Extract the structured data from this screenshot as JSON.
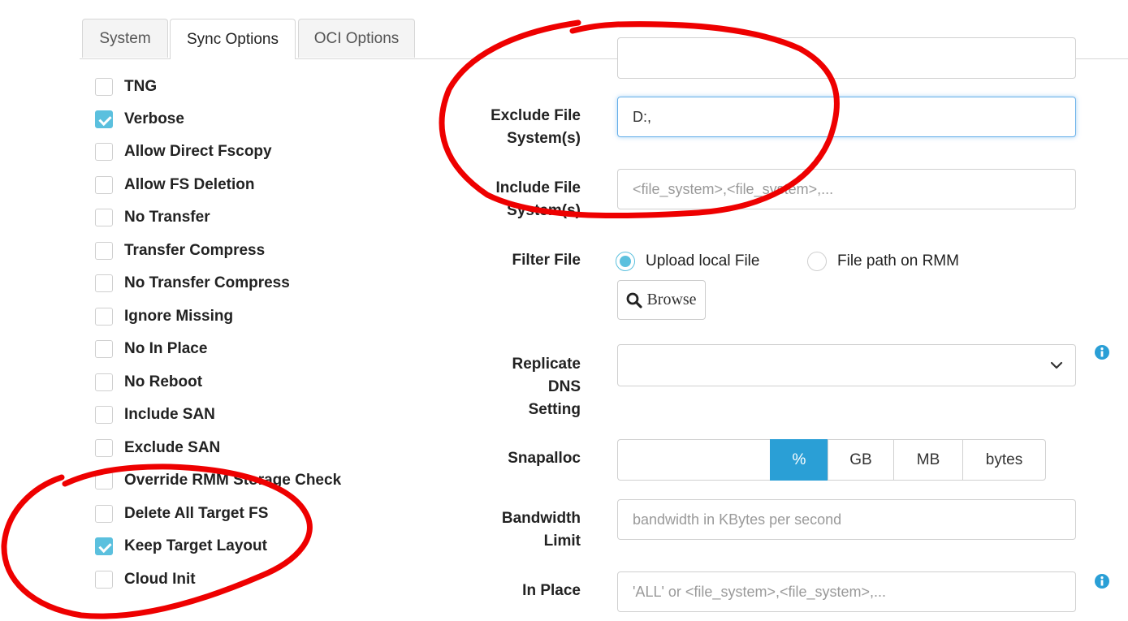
{
  "tabs": [
    {
      "label": "System",
      "active": false
    },
    {
      "label": "Sync Options",
      "active": true
    },
    {
      "label": "OCI Options",
      "active": false
    }
  ],
  "options": [
    {
      "label": "TNG",
      "checked": false
    },
    {
      "label": "Verbose",
      "checked": true
    },
    {
      "label": "Allow Direct Fscopy",
      "checked": false
    },
    {
      "label": "Allow FS Deletion",
      "checked": false
    },
    {
      "label": "No Transfer",
      "checked": false
    },
    {
      "label": "Transfer Compress",
      "checked": false
    },
    {
      "label": "No Transfer Compress",
      "checked": false
    },
    {
      "label": "Ignore Missing",
      "checked": false
    },
    {
      "label": "No In Place",
      "checked": false
    },
    {
      "label": "No Reboot",
      "checked": false
    },
    {
      "label": "Include SAN",
      "checked": false
    },
    {
      "label": "Exclude SAN",
      "checked": false
    },
    {
      "label": "Override RMM Storage Check",
      "checked": false
    },
    {
      "label": "Delete All Target FS",
      "checked": false
    },
    {
      "label": "Keep Target Layout",
      "checked": true
    },
    {
      "label": "Cloud Init",
      "checked": false
    }
  ],
  "form": {
    "exclude_fs": {
      "label": "Exclude File\nSystem(s)",
      "value": "D:,"
    },
    "include_fs": {
      "label": "Include File\nSystem(s)",
      "value": "",
      "placeholder": "<file_system>,<file_system>,..."
    },
    "filter_file": {
      "label": "Filter File",
      "radio_upload": "Upload local File",
      "radio_path": "File path on RMM",
      "selected": "upload",
      "browse_label": "Browse"
    },
    "replicate_dns": {
      "label": "Replicate\nDNS\nSetting",
      "value": ""
    },
    "snapalloc": {
      "label": "Snapalloc",
      "value": "",
      "units": [
        "%",
        "GB",
        "MB",
        "bytes"
      ],
      "active_unit": "%"
    },
    "bandwidth": {
      "label": "Bandwidth\nLimit",
      "value": "",
      "placeholder": "bandwidth in KBytes per second"
    },
    "in_place": {
      "label": "In Place",
      "value": "",
      "placeholder": "'ALL' or <file_system>,<file_system>,..."
    }
  },
  "icons": {
    "info": "info-icon",
    "search": "search-icon",
    "chevron": "chevron-down-icon"
  },
  "colors": {
    "accent": "#5bc0de",
    "active_unit": "#2a9fd6",
    "info": "#2a9fd6",
    "annotation": "#ee0000",
    "focus": "#66afe9"
  }
}
